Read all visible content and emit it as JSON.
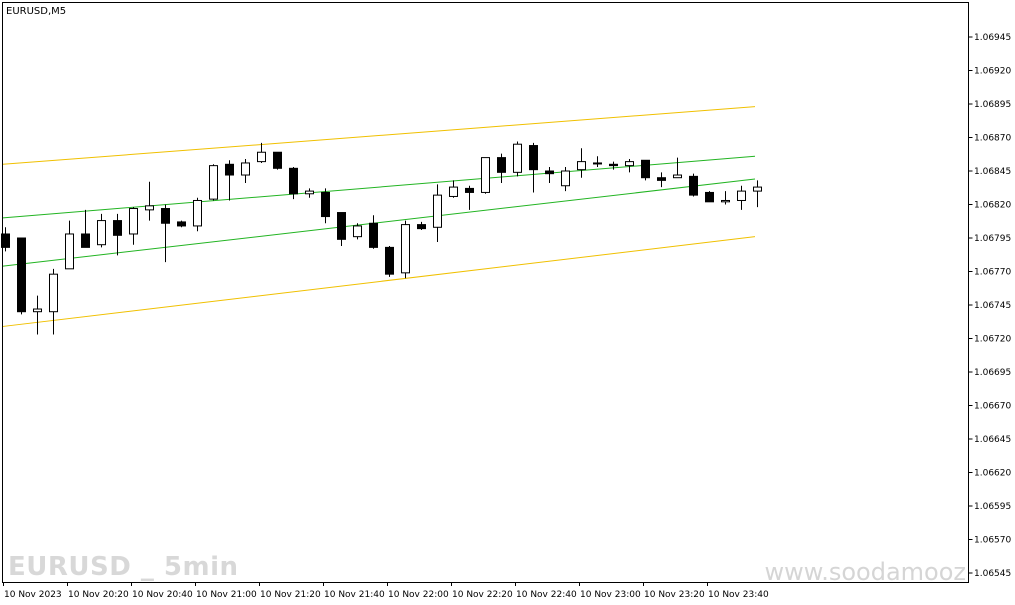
{
  "window": {
    "title": "EURUSD,M5"
  },
  "watermark": {
    "left": "EURUSD _ 5min",
    "right": "www.soodamooz"
  },
  "colors": {
    "background": "#ffffff",
    "candle": "#000000",
    "channel_outer": "#f0c000",
    "channel_inner": "#22b422"
  },
  "chart_data": {
    "type": "candlestick",
    "symbol": "EURUSD",
    "timeframe": "M5",
    "ylim": [
      1.06545,
      1.0696
    ],
    "y_ticks": [
      "1.06945",
      "1.06920",
      "1.06895",
      "1.06870",
      "1.06845",
      "1.06820",
      "1.06795",
      "1.06770",
      "1.06745",
      "1.06720",
      "1.06695",
      "1.06670",
      "1.06645",
      "1.06620",
      "1.06595",
      "1.06570",
      "1.06545"
    ],
    "x_ticks": [
      "10 Nov 2023",
      "10 Nov 20:20",
      "10 Nov 20:40",
      "10 Nov 21:00",
      "10 Nov 21:20",
      "10 Nov 21:40",
      "10 Nov 22:00",
      "10 Nov 22:20",
      "10 Nov 22:40",
      "10 Nov 23:00",
      "10 Nov 23:20",
      "10 Nov 23:40"
    ],
    "candles": [
      {
        "o": 1.06798,
        "h": 1.06803,
        "l": 1.06785,
        "c": 1.06788
      },
      {
        "o": 1.06795,
        "h": 1.06795,
        "l": 1.06738,
        "c": 1.0674
      },
      {
        "o": 1.0674,
        "h": 1.06752,
        "l": 1.06723,
        "c": 1.06742
      },
      {
        "o": 1.0674,
        "h": 1.06772,
        "l": 1.06723,
        "c": 1.06768
      },
      {
        "o": 1.06772,
        "h": 1.06808,
        "l": 1.06772,
        "c": 1.06798
      },
      {
        "o": 1.06798,
        "h": 1.06816,
        "l": 1.06788,
        "c": 1.06788
      },
      {
        "o": 1.0679,
        "h": 1.06813,
        "l": 1.06788,
        "c": 1.06808
      },
      {
        "o": 1.06808,
        "h": 1.06813,
        "l": 1.06782,
        "c": 1.06797
      },
      {
        "o": 1.06798,
        "h": 1.06818,
        "l": 1.0679,
        "c": 1.06817
      },
      {
        "o": 1.06816,
        "h": 1.06837,
        "l": 1.06808,
        "c": 1.06819
      },
      {
        "o": 1.06817,
        "h": 1.0682,
        "l": 1.06777,
        "c": 1.06806
      },
      {
        "o": 1.06807,
        "h": 1.06808,
        "l": 1.06803,
        "c": 1.06804
      },
      {
        "o": 1.06804,
        "h": 1.06825,
        "l": 1.068,
        "c": 1.06823
      },
      {
        "o": 1.06824,
        "h": 1.0685,
        "l": 1.06823,
        "c": 1.06849
      },
      {
        "o": 1.0685,
        "h": 1.06853,
        "l": 1.06823,
        "c": 1.06842
      },
      {
        "o": 1.06842,
        "h": 1.06854,
        "l": 1.06836,
        "c": 1.06851
      },
      {
        "o": 1.06852,
        "h": 1.06866,
        "l": 1.06851,
        "c": 1.06859
      },
      {
        "o": 1.06859,
        "h": 1.06859,
        "l": 1.06846,
        "c": 1.06847
      },
      {
        "o": 1.06847,
        "h": 1.06848,
        "l": 1.06824,
        "c": 1.06828
      },
      {
        "o": 1.06828,
        "h": 1.06832,
        "l": 1.06825,
        "c": 1.0683
      },
      {
        "o": 1.06829,
        "h": 1.06832,
        "l": 1.06806,
        "c": 1.06811
      },
      {
        "o": 1.06814,
        "h": 1.06814,
        "l": 1.06789,
        "c": 1.06794
      },
      {
        "o": 1.06796,
        "h": 1.06806,
        "l": 1.06794,
        "c": 1.06804
      },
      {
        "o": 1.06806,
        "h": 1.06812,
        "l": 1.06787,
        "c": 1.06788
      },
      {
        "o": 1.06788,
        "h": 1.06789,
        "l": 1.06766,
        "c": 1.06768
      },
      {
        "o": 1.06769,
        "h": 1.06808,
        "l": 1.06765,
        "c": 1.06805
      },
      {
        "o": 1.06805,
        "h": 1.06807,
        "l": 1.06801,
        "c": 1.06802
      },
      {
        "o": 1.06803,
        "h": 1.06835,
        "l": 1.06792,
        "c": 1.06827
      },
      {
        "o": 1.06826,
        "h": 1.06838,
        "l": 1.06825,
        "c": 1.06833
      },
      {
        "o": 1.06832,
        "h": 1.06834,
        "l": 1.06816,
        "c": 1.06829
      },
      {
        "o": 1.06829,
        "h": 1.06855,
        "l": 1.06828,
        "c": 1.06855
      },
      {
        "o": 1.06855,
        "h": 1.06858,
        "l": 1.06836,
        "c": 1.06844
      },
      {
        "o": 1.06844,
        "h": 1.06867,
        "l": 1.06841,
        "c": 1.06865
      },
      {
        "o": 1.06864,
        "h": 1.06866,
        "l": 1.06829,
        "c": 1.06846
      },
      {
        "o": 1.06845,
        "h": 1.06848,
        "l": 1.06836,
        "c": 1.06843
      },
      {
        "o": 1.06834,
        "h": 1.06848,
        "l": 1.0683,
        "c": 1.06845
      },
      {
        "o": 1.06846,
        "h": 1.06862,
        "l": 1.0684,
        "c": 1.06852
      },
      {
        "o": 1.06851,
        "h": 1.06856,
        "l": 1.06848,
        "c": 1.06851
      },
      {
        "o": 1.0685,
        "h": 1.06852,
        "l": 1.06846,
        "c": 1.06849
      },
      {
        "o": 1.06849,
        "h": 1.06854,
        "l": 1.06844,
        "c": 1.06852
      },
      {
        "o": 1.06853,
        "h": 1.06853,
        "l": 1.06838,
        "c": 1.0684
      },
      {
        "o": 1.0684,
        "h": 1.06844,
        "l": 1.06833,
        "c": 1.06838
      },
      {
        "o": 1.0684,
        "h": 1.06855,
        "l": 1.0684,
        "c": 1.06842
      },
      {
        "o": 1.06841,
        "h": 1.06843,
        "l": 1.06826,
        "c": 1.06827
      },
      {
        "o": 1.06829,
        "h": 1.0683,
        "l": 1.06822,
        "c": 1.06822
      },
      {
        "o": 1.06822,
        "h": 1.0683,
        "l": 1.0682,
        "c": 1.06823
      },
      {
        "o": 1.06823,
        "h": 1.06834,
        "l": 1.06816,
        "c": 1.0683
      },
      {
        "o": 1.0683,
        "h": 1.06838,
        "l": 1.06818,
        "c": 1.06833
      }
    ],
    "channel_lines": [
      {
        "role": "outer-upper",
        "color": "#f0c000",
        "y_start": 1.0685,
        "y_end": 1.06893
      },
      {
        "role": "inner-upper",
        "color": "#22b422",
        "y_start": 1.0681,
        "y_end": 1.06856
      },
      {
        "role": "inner-lower",
        "color": "#22b422",
        "y_start": 1.06774,
        "y_end": 1.06839
      },
      {
        "role": "outer-lower",
        "color": "#f0c000",
        "y_start": 1.06729,
        "y_end": 1.06796
      }
    ]
  }
}
